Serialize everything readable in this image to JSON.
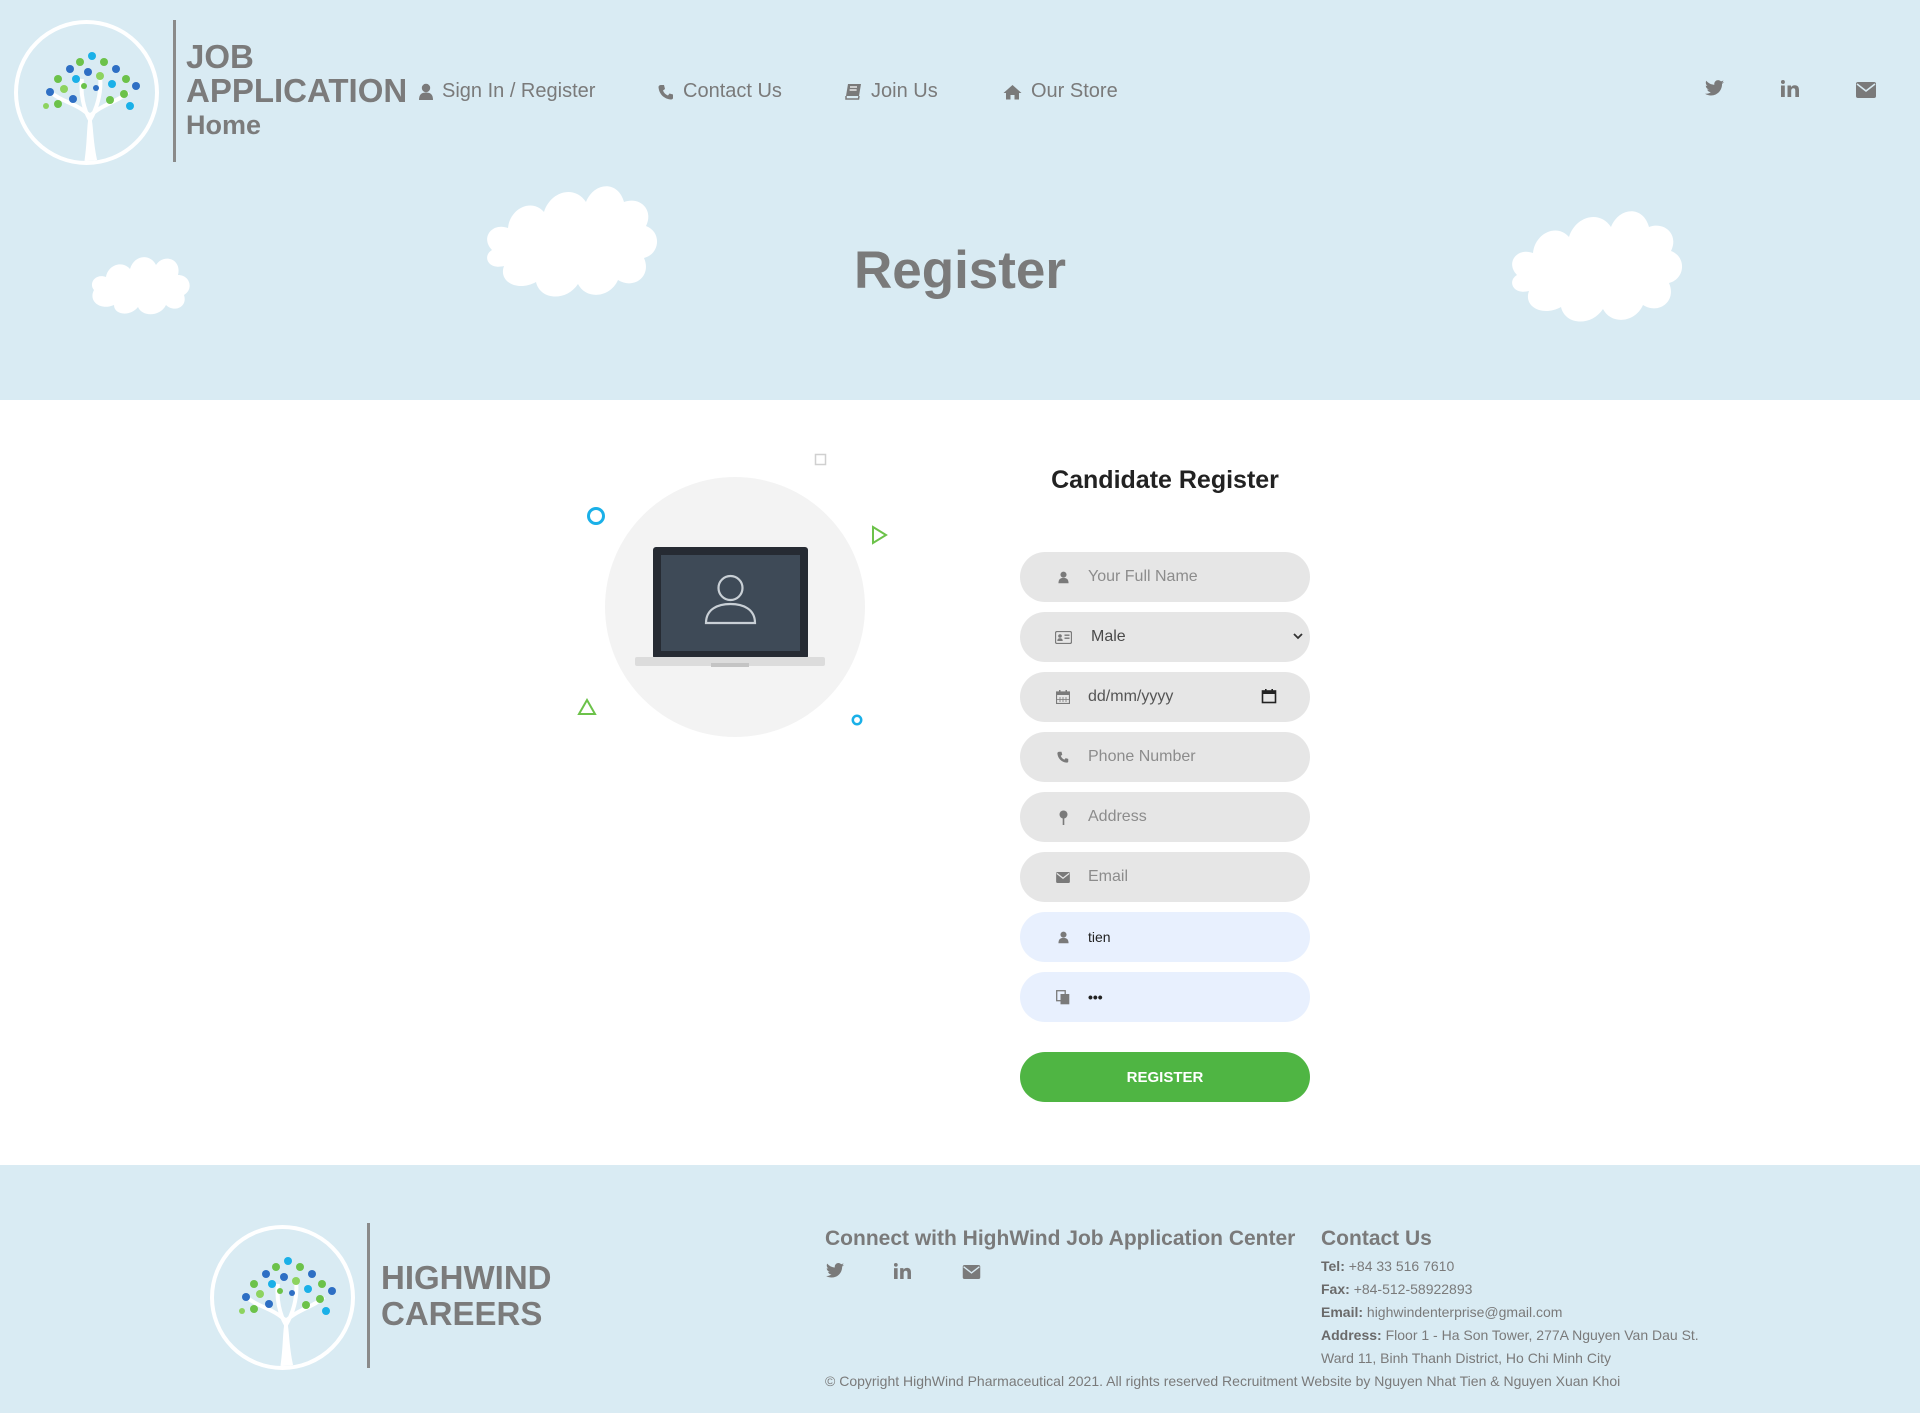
{
  "header": {
    "brand_line1": "JOB",
    "brand_line2": "APPLICATION",
    "brand_line3": "Home",
    "nav": [
      {
        "label": "Sign In / Register",
        "icon": "user-icon"
      },
      {
        "label": "Contact Us",
        "icon": "phone-icon"
      },
      {
        "label": "Join Us",
        "icon": "book-icon"
      },
      {
        "label": "Our Store",
        "icon": "home-icon"
      }
    ],
    "social": [
      "twitter-icon",
      "linkedin-icon",
      "envelope-icon"
    ]
  },
  "page_title": "Register",
  "form": {
    "title": "Candidate Register",
    "full_name_placeholder": "Your Full Name",
    "gender_value": "Male",
    "dob_placeholder": "dd/mm/yyyy",
    "phone_placeholder": "Phone Number",
    "address_placeholder": "Address",
    "email_placeholder": "Email",
    "username_value": "tien",
    "password_value": "•••",
    "submit_label": "REGISTER"
  },
  "footer": {
    "brand_line1": "HIGHWIND",
    "brand_line2": "CAREERS",
    "connect_heading": "Connect with HighWind Job Application Center",
    "contact_heading": "Contact Us",
    "tel_label": "Tel:",
    "tel_value": "+84 33 516 7610",
    "fax_label": "Fax:",
    "fax_value": "+84-512-58922893",
    "email_label": "Email:",
    "email_value": "highwindenterprise@gmail.com",
    "address_label": "Address:",
    "address_line1": "Floor 1 - Ha Son Tower, 277A Nguyen Van Dau St.",
    "address_line2": "Ward 11, Binh Thanh District, Ho Chi Minh City",
    "copyright": "© Copyright HighWind Pharmaceutical 2021. All rights reserved Recruitment Website by Nguyen Nhat Tien & Nguyen Xuan Khoi"
  },
  "colors": {
    "hero_bg": "#d9ebf3",
    "text_gray": "#7a7a7a",
    "field_bg": "#e6e6e6",
    "field_filled_bg": "#e8f0fe",
    "button_green": "#4fb543",
    "accent_blue": "#1ab0e8",
    "accent_green": "#6cc24a"
  }
}
